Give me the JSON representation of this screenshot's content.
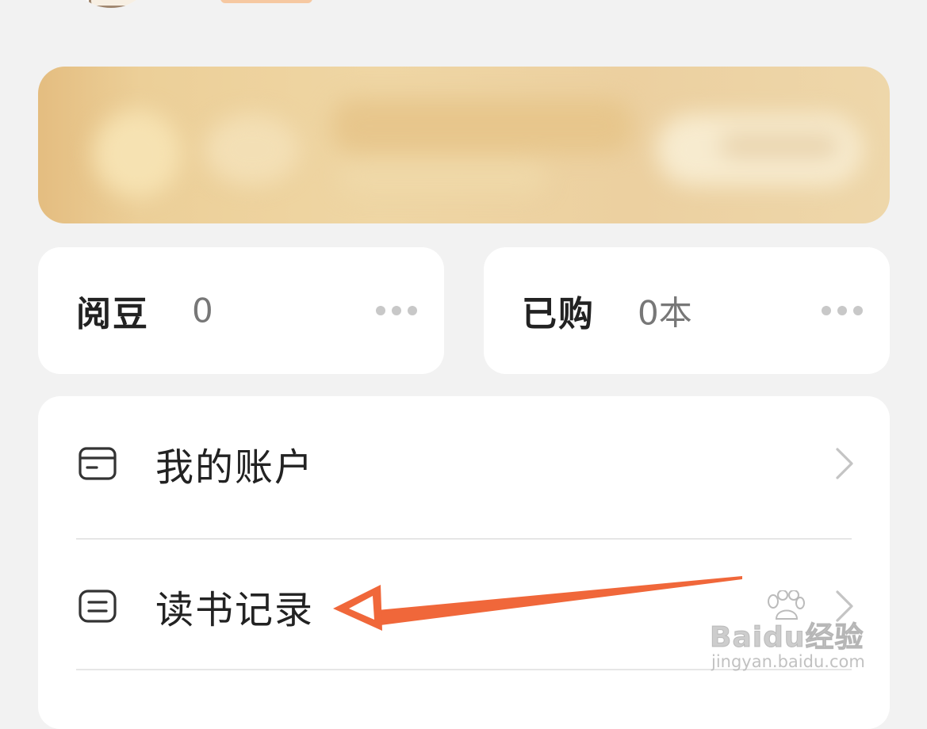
{
  "stats": {
    "beans": {
      "label": "阅豆",
      "value": "0"
    },
    "purchased": {
      "label": "已购",
      "value": "0本"
    }
  },
  "menu": {
    "items": [
      {
        "label": "我的账户",
        "icon": "wallet-icon"
      },
      {
        "label": "读书记录",
        "icon": "reading-record-icon"
      }
    ]
  },
  "watermark": {
    "brand": "Baidu经验",
    "url": "jingyan.baidu.com"
  },
  "colors": {
    "background": "#f2f2f2",
    "card": "#ffffff",
    "vip_banner": "#ecd0a0",
    "annotation_arrow": "#f0673a"
  }
}
